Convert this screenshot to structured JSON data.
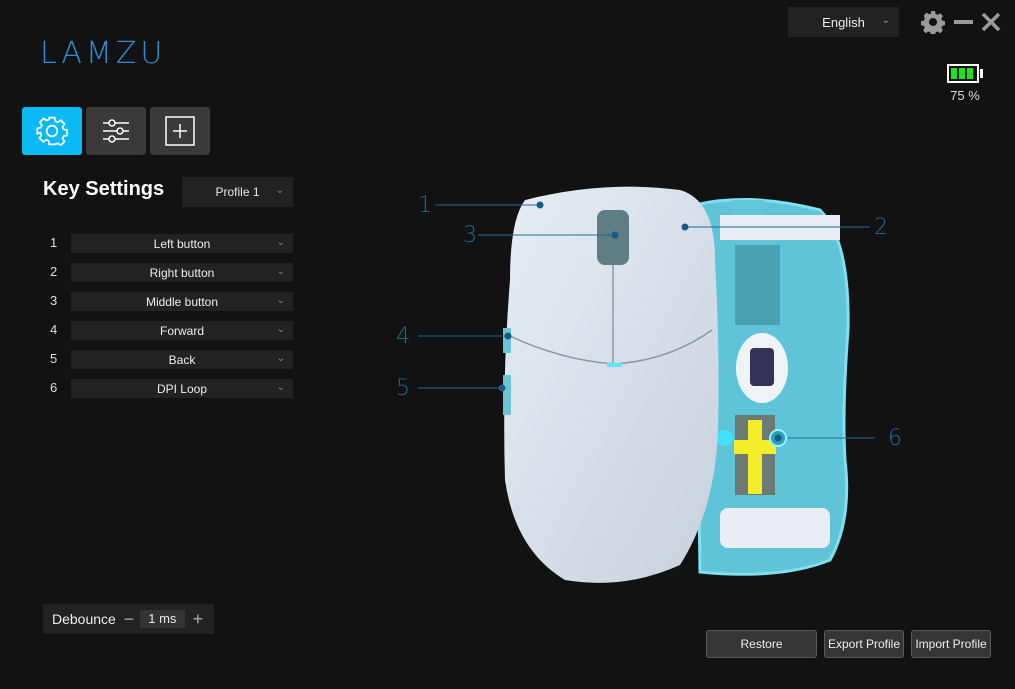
{
  "brand": {
    "logo": "LAMZU",
    "accent": "#0bbaf5"
  },
  "titlebar": {
    "language": "English",
    "settings_icon": "gear-icon",
    "minimize_icon": "minimize-icon",
    "close_icon": "close-icon"
  },
  "battery": {
    "level_percent": 75,
    "text": "75 %",
    "color": "#19e61a"
  },
  "nav": [
    {
      "name": "key-settings",
      "icon": "gear-icon",
      "active": true
    },
    {
      "name": "performance",
      "icon": "sliders-icon",
      "active": false
    },
    {
      "name": "macro",
      "icon": "plus-square-icon",
      "active": false
    }
  ],
  "key_settings": {
    "title": "Key Settings",
    "profile": "Profile 1",
    "keys": [
      {
        "num": "1",
        "action": "Left button"
      },
      {
        "num": "2",
        "action": "Right button"
      },
      {
        "num": "3",
        "action": "Middle button"
      },
      {
        "num": "4",
        "action": "Forward"
      },
      {
        "num": "5",
        "action": "Back"
      },
      {
        "num": "6",
        "action": "DPI Loop"
      }
    ]
  },
  "debounce": {
    "label": "Debounce",
    "value": "1 ms",
    "minus": "−",
    "plus": "+"
  },
  "callouts": [
    "1",
    "2",
    "3",
    "4",
    "5",
    "6"
  ],
  "footer": {
    "restore": "Restore",
    "export": "Export Profile",
    "import": "Import Profile"
  }
}
